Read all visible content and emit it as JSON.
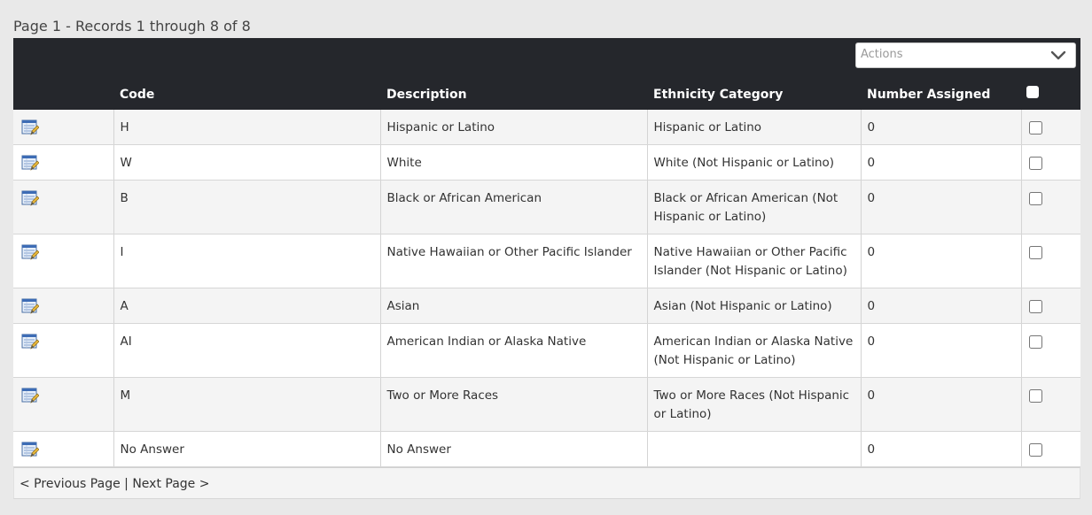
{
  "page_info": "Page 1 - Records 1 through 8 of 8",
  "actions": {
    "placeholder": "Actions",
    "chevron_icon": "chevron-down-icon"
  },
  "columns": [
    "Code",
    "Description",
    "Ethnicity Category",
    "Number Assigned"
  ],
  "rows": [
    {
      "code": "H",
      "description": "Hispanic or Latino",
      "category": "Hispanic or Latino",
      "assigned": "0"
    },
    {
      "code": "W",
      "description": "White",
      "category": "White (Not Hispanic or Latino)",
      "assigned": "0"
    },
    {
      "code": "B",
      "description": "Black or African American",
      "category": "Black or African American (Not Hispanic or Latino)",
      "assigned": "0"
    },
    {
      "code": "I",
      "description": "Native Hawaiian or Other Pacific Islander",
      "category": "Native Hawaiian or Other Pacific Islander (Not Hispanic or Latino)",
      "assigned": "0"
    },
    {
      "code": "A",
      "description": "Asian",
      "category": "Asian (Not Hispanic or Latino)",
      "assigned": "0"
    },
    {
      "code": "AI",
      "description": "American Indian or Alaska Native",
      "category": "American Indian or Alaska Native (Not Hispanic or Latino)",
      "assigned": "0"
    },
    {
      "code": "M",
      "description": "Two or More Races",
      "category": "Two or More Races (Not Hispanic or Latino)",
      "assigned": "0"
    },
    {
      "code": "No Answer",
      "description": "No Answer",
      "category": "",
      "assigned": "0"
    }
  ],
  "row_icon": "edit-record-icon",
  "footer": {
    "prev": "< Previous Page",
    "separator": "|",
    "next": "Next Page >"
  },
  "colors": {
    "header_bg": "#25272c",
    "page_bg": "#e9e9e9",
    "row_alt": "#f4f4f4"
  }
}
